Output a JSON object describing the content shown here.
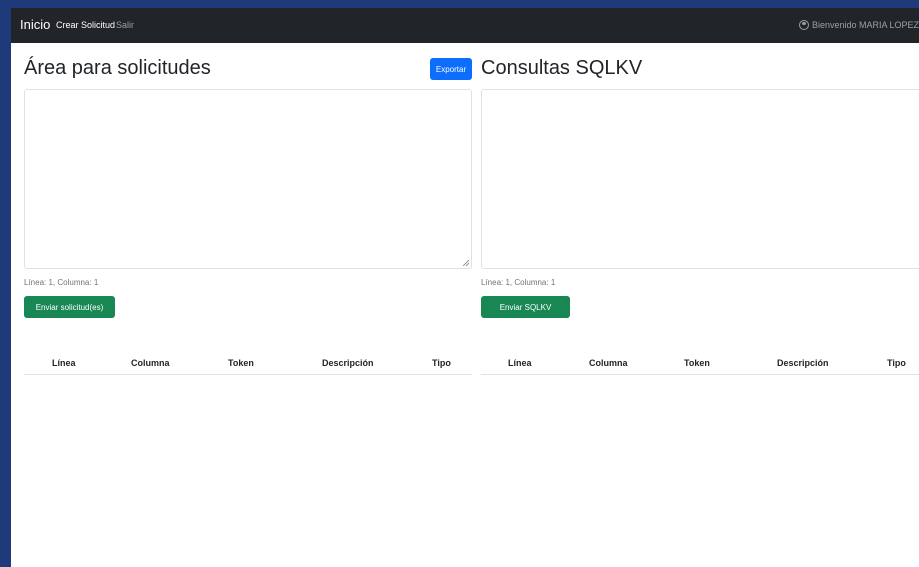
{
  "navbar": {
    "brand": "Inicio",
    "links": [
      "Crear Solicitud",
      "Salir"
    ],
    "welcome": "Bienvenido MARIA LOPEZ"
  },
  "left": {
    "title": "Área para solicitudes",
    "export_label": "Exportar",
    "editor_value": "",
    "position": "Línea: 1, Columna: 1",
    "send_label": "Enviar solicitud(es)",
    "columns": [
      "Línea",
      "Columna",
      "Token",
      "Descripción",
      "Tipo"
    ]
  },
  "right": {
    "title": "Consultas SQLKV",
    "editor_value": "",
    "position": "Línea: 1, Columna: 1",
    "send_label": "Enviar SQLKV",
    "columns": [
      "Línea",
      "Columna",
      "Token",
      "Descripción",
      "Tipo"
    ]
  },
  "colors": {
    "navbar": "#212529",
    "primary": "#0d6efd",
    "success": "#198754",
    "frame": "#1f3a7a"
  },
  "icons": {
    "welcome": "user-circle-icon"
  }
}
